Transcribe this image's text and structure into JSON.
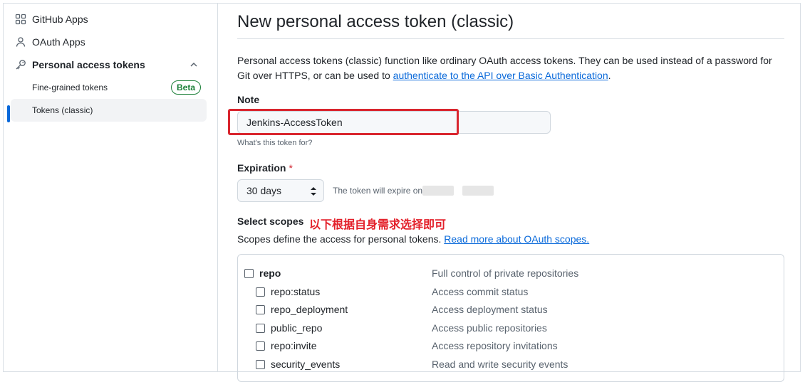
{
  "sidebar": {
    "github_apps": "GitHub Apps",
    "oauth_apps": "OAuth Apps",
    "personal_access_tokens": "Personal access tokens",
    "fine_grained": "Fine-grained tokens",
    "beta": "Beta",
    "tokens_classic": "Tokens (classic)"
  },
  "main": {
    "title": "New personal access token (classic)",
    "desc_part1": "Personal access tokens (classic) function like ordinary OAuth access tokens. They can be used instead of a password for Git over HTTPS, or can be used to ",
    "desc_link": "authenticate to the API over Basic Authentication",
    "desc_end": ".",
    "note_label": "Note",
    "note_value": "Jenkins-AccessToken",
    "note_hint": "What's this token for?",
    "expiration_label": "Expiration",
    "expiration_required": "*",
    "expiration_value": "30 days",
    "expire_text": "The token will expire on",
    "select_scopes_label": "Select scopes",
    "annotation": "以下根据自身需求选择即可",
    "scopes_desc": "Scopes define the access for personal tokens. ",
    "scopes_link": "Read more about OAuth scopes.",
    "scopes": [
      {
        "name": "repo",
        "desc": "Full control of private repositories",
        "child": false,
        "bold": true
      },
      {
        "name": "repo:status",
        "desc": "Access commit status",
        "child": true
      },
      {
        "name": "repo_deployment",
        "desc": "Access deployment status",
        "child": true
      },
      {
        "name": "public_repo",
        "desc": "Access public repositories",
        "child": true
      },
      {
        "name": "repo:invite",
        "desc": "Access repository invitations",
        "child": true
      },
      {
        "name": "security_events",
        "desc": "Read and write security events",
        "child": true
      }
    ]
  },
  "colors": {
    "accent": "#0969da",
    "annotation_red": "#e3202a",
    "beta_green": "#1a7f37"
  }
}
